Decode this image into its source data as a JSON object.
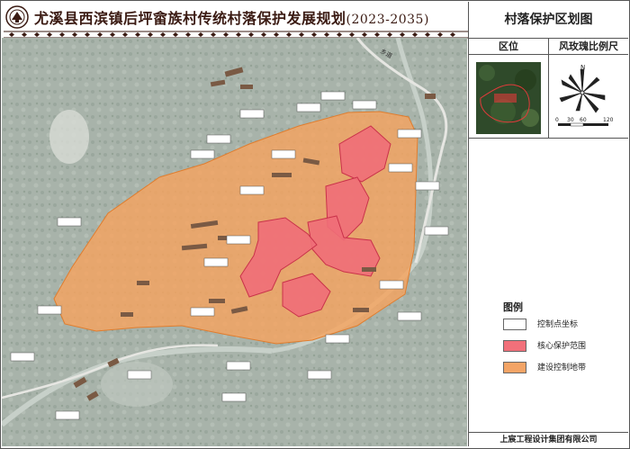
{
  "title": {
    "main": "尤溪县西滨镇后坪畲族村传统村落保护发展规划",
    "years": "(2023-2035)"
  },
  "panel": {
    "title": "村落保护区划图",
    "location_label": "区位",
    "windrose_label": "风玫瑰比例尺",
    "scale_ticks": [
      "0",
      "30",
      "60",
      "120"
    ],
    "north": "N"
  },
  "legend": {
    "title": "图例",
    "items": [
      {
        "label": "控制点坐标",
        "color": "#ffffff"
      },
      {
        "label": "核心保护范围",
        "color": "#f2707a"
      },
      {
        "label": "建设控制地带",
        "color": "#f3a466"
      }
    ]
  },
  "footer": "上宸工程设计集团有限公司",
  "map": {
    "road_label": "乡道",
    "colors": {
      "core": "#f06e78",
      "control": "#f5a35f",
      "terrain": "#a9b4ab"
    }
  }
}
